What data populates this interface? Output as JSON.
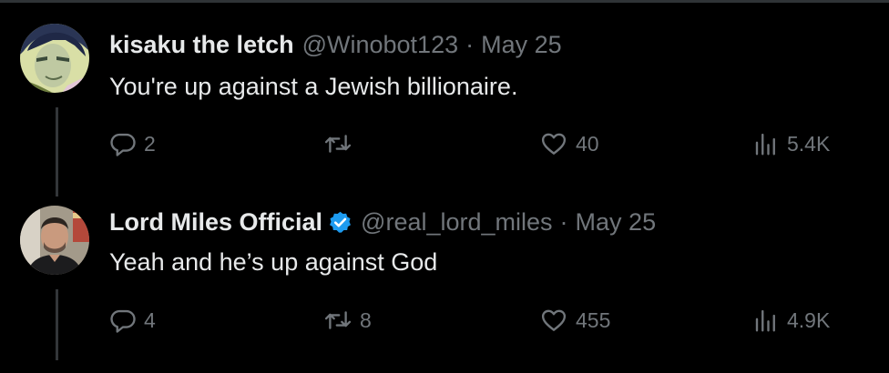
{
  "tweets": [
    {
      "display_name": "kisaku the letch",
      "handle": "@Winobot123",
      "separator": "·",
      "date": "May 25",
      "text": "You're up against a Jewish billionaire.",
      "verified": false,
      "avatar": "anime-character-avatar",
      "actions": {
        "replies": "2",
        "retweets": "",
        "likes": "40",
        "views": "5.4K"
      }
    },
    {
      "display_name": "Lord Miles Official",
      "handle": "@real_lord_miles",
      "separator": "·",
      "date": "May 25",
      "text": "Yeah and he’s up against God",
      "verified": true,
      "avatar": "man-photo-avatar",
      "actions": {
        "replies": "4",
        "retweets": "8",
        "likes": "455",
        "views": "4.9K"
      }
    }
  ],
  "icons": {
    "reply": "reply-icon",
    "retweet": "retweet-icon",
    "like": "heart-icon",
    "views": "views-icon",
    "verified": "verified-badge-icon"
  },
  "colors": {
    "background": "#000000",
    "primary_text": "#e7e9ea",
    "secondary_text": "#71767b",
    "verified_blue": "#1d9bf0",
    "thread_line": "#333639"
  }
}
